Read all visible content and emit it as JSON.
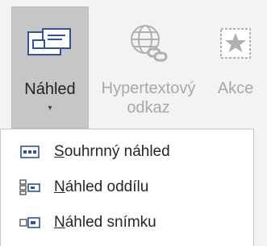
{
  "ribbon": {
    "buttons": [
      {
        "label_line1": "Náhled",
        "label_line2": "",
        "caret": "▾",
        "icon": "summary-zoom-icon",
        "state": "active"
      },
      {
        "label_line1": "Hypertextový",
        "label_line2": "odkaz",
        "icon": "hyperlink-globe-icon",
        "state": "disabled"
      },
      {
        "label_line1": "Akce",
        "label_line2": "",
        "icon": "action-star-icon",
        "state": "disabled"
      }
    ]
  },
  "menu": {
    "items": [
      {
        "access_key": "S",
        "rest": "ouhrnný náhled",
        "icon": "summary-zoom-small-icon"
      },
      {
        "access_key": "N",
        "rest": "áhled oddílu",
        "icon": "section-zoom-small-icon"
      },
      {
        "access_key": "N",
        "rest": "áhled snímku",
        "icon": "slide-zoom-small-icon"
      }
    ]
  },
  "colors": {
    "accent": "#2f5597",
    "accent_fill": "#ffffff",
    "disabled": "#b0b0b0",
    "menu_bg": "#ffffff",
    "ribbon_bg": "#f3f3f3",
    "active_bg": "#c6c6c6"
  }
}
